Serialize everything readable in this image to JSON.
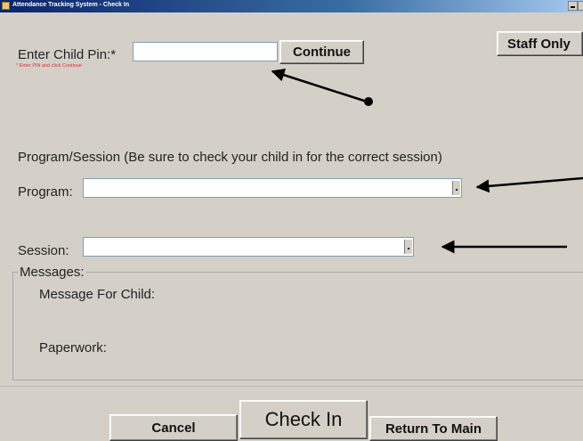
{
  "window": {
    "title": "Attendance Tracking System - Check In"
  },
  "pin": {
    "label": "Enter Child Pin:*",
    "value": "",
    "hint": "* Enter PIN and click Continue",
    "continue_label": "Continue"
  },
  "staff_only_label": "Staff Only",
  "program_session": {
    "heading": "Program/Session (Be sure to check your child in for the correct session)",
    "program_label": "Program:",
    "program_value": "",
    "session_label": "Session:",
    "session_value": ""
  },
  "messages": {
    "legend": "Messages:",
    "child_label": "Message For Child:",
    "paperwork_label": "Paperwork:"
  },
  "actions": {
    "cancel_label": "Cancel",
    "checkin_label": "Check In",
    "return_label": "Return To Main"
  },
  "colors": {
    "background": "#d4d0c8",
    "titlebar": "#0a246a",
    "hint": "#e03030"
  }
}
